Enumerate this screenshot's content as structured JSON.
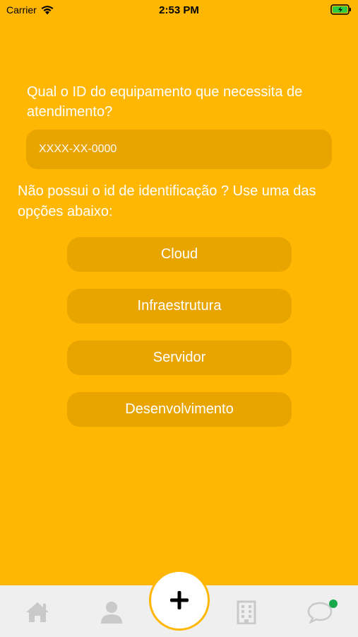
{
  "status_bar": {
    "carrier": "Carrier",
    "time": "2:53 PM"
  },
  "form": {
    "question": "Qual o ID do equipamento que necessita de atendimento?",
    "id_placeholder": "XXXX-XX-0000",
    "hint": "Não possui o id de identificação ? Use uma das opções abaixo:"
  },
  "options": [
    {
      "label": "Cloud"
    },
    {
      "label": "Infraestrutura"
    },
    {
      "label": "Servidor"
    },
    {
      "label": "Desenvolvimento"
    }
  ],
  "tab_bar": {
    "items": [
      {
        "icon": "home-icon"
      },
      {
        "icon": "user-icon"
      },
      {
        "icon": "add-icon"
      },
      {
        "icon": "building-icon"
      },
      {
        "icon": "chat-icon"
      }
    ]
  },
  "colors": {
    "background": "#FFB703",
    "field": "#E8A500",
    "tab_bar": "#EFEFEF",
    "notification": "#19A74B"
  }
}
